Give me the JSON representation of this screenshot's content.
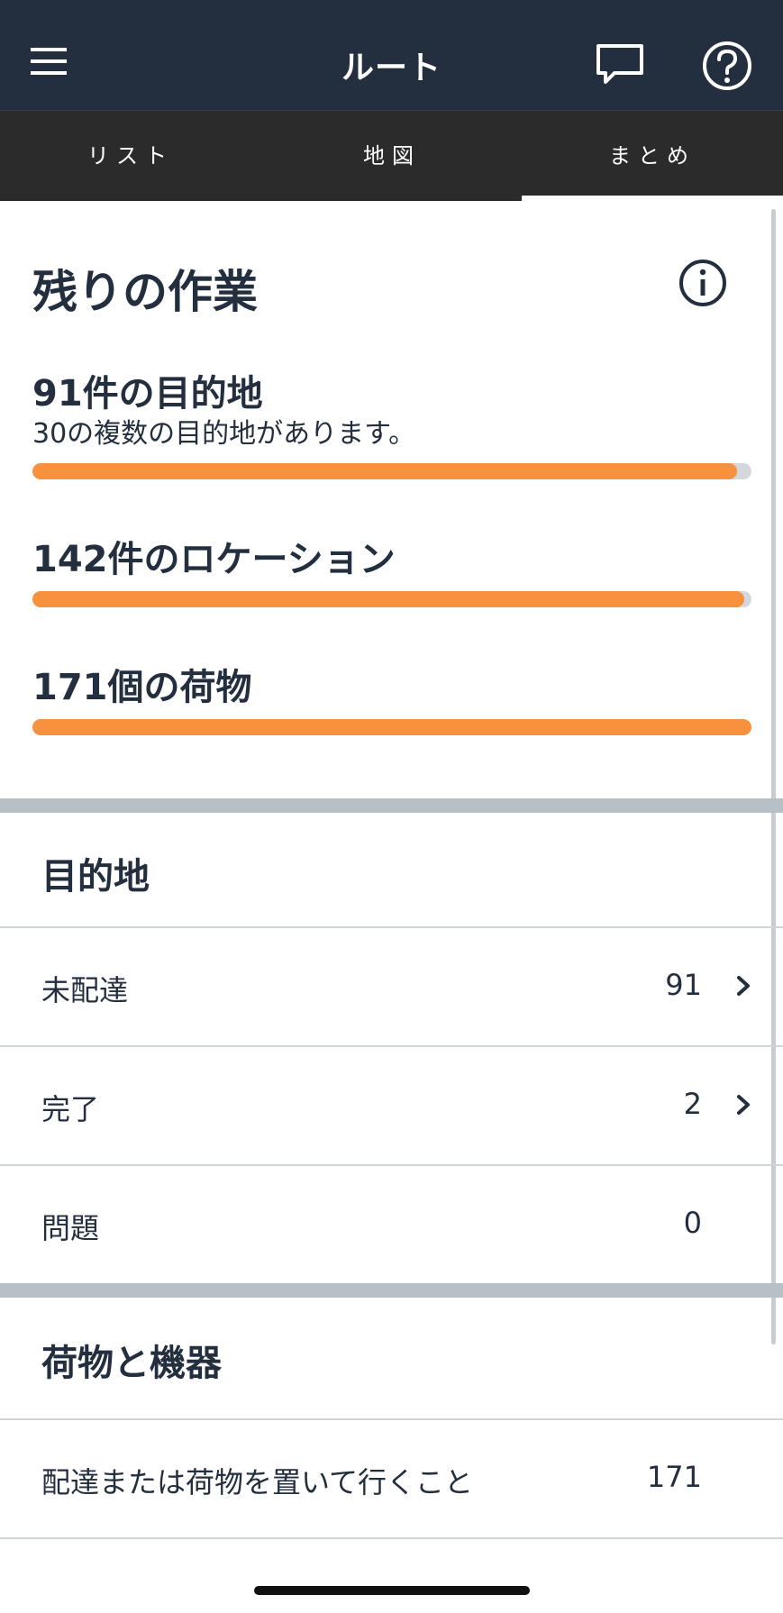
{
  "header": {
    "title": "ルート",
    "icons": [
      "menu-icon",
      "chat-icon",
      "help-icon"
    ]
  },
  "tabs": [
    {
      "label": "リスト",
      "active": false
    },
    {
      "label": "地図",
      "active": false
    },
    {
      "label": "まとめ",
      "active": true
    }
  ],
  "remaining": {
    "title": "残りの作業",
    "info_icon": "info-icon",
    "metrics": [
      {
        "title": "91件の目的地",
        "subtitle": "30の複数の目的地があります。",
        "progress": 0.98
      },
      {
        "title": "142件のロケーション",
        "progress": 0.99
      },
      {
        "title": "171個の荷物",
        "progress": 1.0
      }
    ]
  },
  "destinations": {
    "title": "目的地",
    "rows": [
      {
        "label": "未配達",
        "value": "91",
        "chevron": true
      },
      {
        "label": "完了",
        "value": "2",
        "chevron": true
      },
      {
        "label": "問題",
        "value": "0",
        "chevron": false
      }
    ]
  },
  "packages": {
    "title": "荷物と機器",
    "rows": [
      {
        "label": "配達または荷物を置いて行くこと",
        "value": "171",
        "chevron": false
      }
    ]
  },
  "colors": {
    "header_bg": "#232f3e",
    "tab_bg": "#2b2b2b",
    "progress": "#f7913d",
    "track": "#d4d8dc",
    "separator": "#b7c0c7"
  }
}
